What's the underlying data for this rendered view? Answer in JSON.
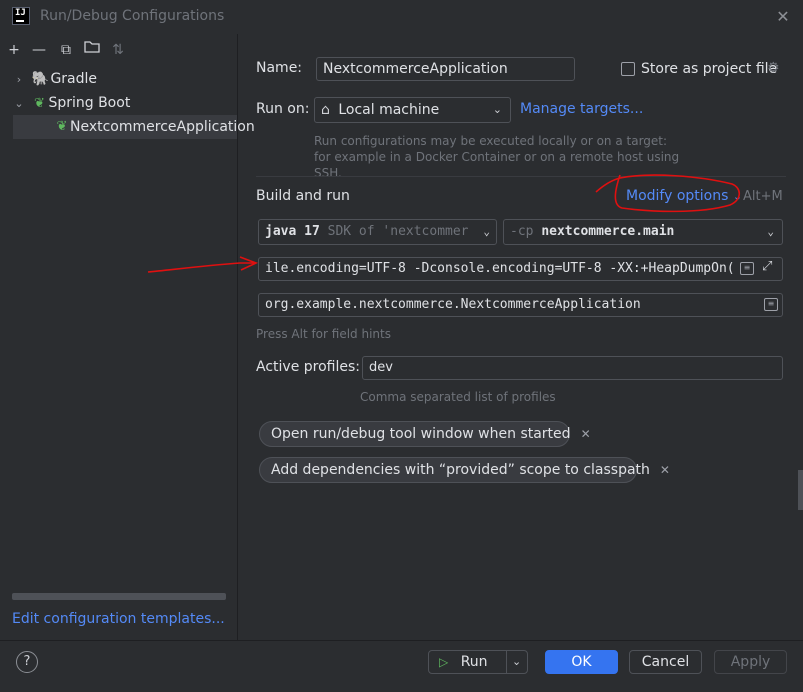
{
  "window": {
    "title": "Run/Debug Configurations",
    "app_icon_text": "IJ"
  },
  "toolbar": {
    "icons": [
      "plus-icon",
      "minus-icon",
      "copy-icon",
      "folder-icon",
      "sort-icon"
    ]
  },
  "tree": {
    "items": [
      {
        "label": "Gradle",
        "expanded": false
      },
      {
        "label": "Spring Boot",
        "expanded": true
      },
      {
        "label": "NextcommerceApplication",
        "selected": true
      }
    ]
  },
  "left_footer": {
    "edit_templates": "Edit configuration templates..."
  },
  "form": {
    "name_label": "Name:",
    "name_value": "NextcommerceApplication",
    "store_project_file": "Store as project file",
    "run_on_label": "Run on:",
    "run_on_value": "Local machine",
    "manage_targets": "Manage targets...",
    "run_on_hint": "Run configurations may be executed locally or on a target: for example in a Docker Container or on a remote host using SSH.",
    "build_run_title": "Build and run",
    "modify_options": "Modify options",
    "modify_options_shortcut": "Alt+M",
    "jdk_bold": "java 17",
    "jdk_rest": "SDK of 'nextcommer",
    "cp_prefix": "-cp",
    "cp_value": "nextcommerce.main",
    "vm_options": "ile.encoding=UTF-8 -Dconsole.encoding=UTF-8 -XX:+HeapDumpOn(",
    "main_class": "org.example.nextcommerce.NextcommerceApplication",
    "field_hints": "Press Alt for field hints",
    "active_profiles_label": "Active profiles:",
    "active_profiles_value": "dev",
    "profiles_hint": "Comma separated list of profiles",
    "chips": [
      "Open run/debug tool window when started",
      "Add dependencies with “provided” scope to classpath"
    ]
  },
  "buttons": {
    "help": "?",
    "run": "Run",
    "ok": "OK",
    "cancel": "Cancel",
    "apply": "Apply"
  },
  "colors": {
    "accent": "#3574f0",
    "link": "#548af7",
    "annotation": "#e01010",
    "spring_green": "#5fb85f"
  }
}
